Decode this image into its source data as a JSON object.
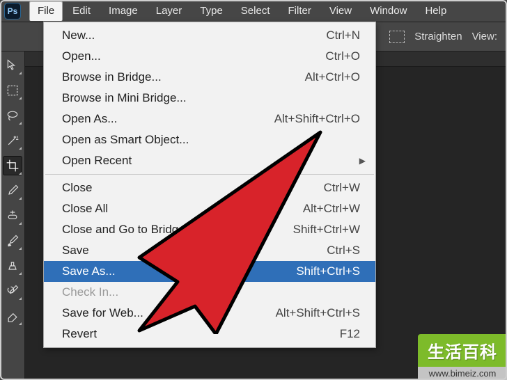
{
  "app": {
    "logo_text": "Ps"
  },
  "menubar": {
    "items": [
      {
        "label": "File"
      },
      {
        "label": "Edit"
      },
      {
        "label": "Image"
      },
      {
        "label": "Layer"
      },
      {
        "label": "Type"
      },
      {
        "label": "Select"
      },
      {
        "label": "Filter"
      },
      {
        "label": "View"
      },
      {
        "label": "Window"
      },
      {
        "label": "Help"
      }
    ]
  },
  "optionsbar": {
    "straighten_label": "Straighten",
    "view_label": "View:"
  },
  "file_menu": {
    "items": [
      {
        "label": "New...",
        "shortcut": "Ctrl+N",
        "type": "item"
      },
      {
        "label": "Open...",
        "shortcut": "Ctrl+O",
        "type": "item"
      },
      {
        "label": "Browse in Bridge...",
        "shortcut": "Alt+Ctrl+O",
        "type": "item"
      },
      {
        "label": "Browse in Mini Bridge...",
        "shortcut": "",
        "type": "item"
      },
      {
        "label": "Open As...",
        "shortcut": "Alt+Shift+Ctrl+O",
        "type": "item"
      },
      {
        "label": "Open as Smart Object...",
        "shortcut": "",
        "type": "item"
      },
      {
        "label": "Open Recent",
        "shortcut": "",
        "type": "submenu"
      },
      {
        "type": "separator"
      },
      {
        "label": "Close",
        "shortcut": "Ctrl+W",
        "type": "item"
      },
      {
        "label": "Close All",
        "shortcut": "Alt+Ctrl+W",
        "type": "item"
      },
      {
        "label": "Close and Go to Bridge...",
        "shortcut": "Shift+Ctrl+W",
        "type": "item"
      },
      {
        "label": "Save",
        "shortcut": "Ctrl+S",
        "type": "item"
      },
      {
        "label": "Save As...",
        "shortcut": "Shift+Ctrl+S",
        "type": "item",
        "highlight": true
      },
      {
        "label": "Check In...",
        "shortcut": "",
        "type": "item",
        "disabled": true
      },
      {
        "label": "Save for Web...",
        "shortcut": "Alt+Shift+Ctrl+S",
        "type": "item"
      },
      {
        "label": "Revert",
        "shortcut": "F12",
        "type": "item"
      }
    ]
  },
  "watermark": {
    "badge": "生活百科",
    "url": "www.bimeiz.com"
  }
}
